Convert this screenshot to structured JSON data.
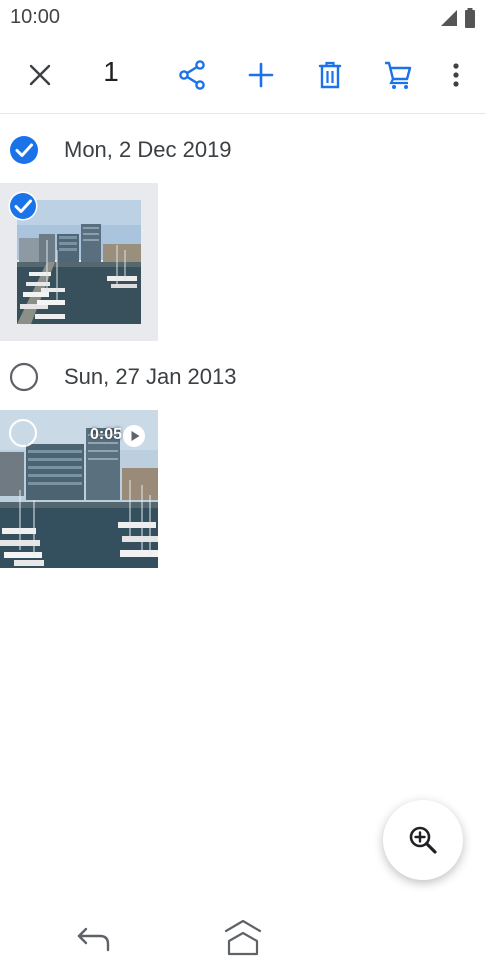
{
  "status_bar": {
    "time": "10:00",
    "icons": [
      "signal-icon",
      "battery-icon"
    ]
  },
  "action_bar": {
    "selected_count": "1",
    "icons": [
      "close-icon",
      "share-icon",
      "add-icon",
      "delete-icon",
      "cart-icon",
      "more-vert-icon"
    ],
    "accent_color": "#1a73e8"
  },
  "groups": [
    {
      "date": "Mon, 2 Dec 2019",
      "group_selected": true,
      "items": [
        {
          "type": "photo",
          "selected": true
        }
      ]
    },
    {
      "date": "Sun, 27 Jan 2013",
      "group_selected": false,
      "items": [
        {
          "type": "video",
          "selected": false,
          "duration": "0:05"
        }
      ]
    }
  ],
  "fab": {
    "icon": "zoom-in-icon"
  },
  "nav_bar": {
    "icons": [
      "back-icon",
      "home-icon"
    ]
  }
}
